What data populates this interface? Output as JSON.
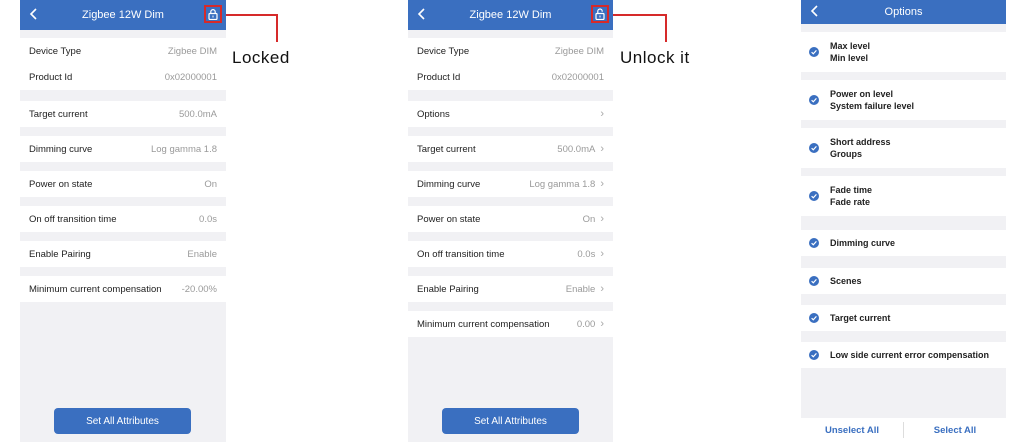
{
  "colors": {
    "primary": "#3a6fc0",
    "highlight": "#d62a2a",
    "background": "#f1f1f4"
  },
  "locked_screen": {
    "title": "Zigbee 12W Dim",
    "lock_icon": "lock-closed-icon",
    "rows": [
      {
        "label": "Device Type",
        "value": "Zigbee DIM"
      },
      {
        "label": "Product Id",
        "value": "0x02000001"
      },
      {
        "label": "Target current",
        "value": "500.0mA"
      },
      {
        "label": "Dimming curve",
        "value": "Log gamma 1.8"
      },
      {
        "label": "Power on state",
        "value": "On"
      },
      {
        "label": "On off transition time",
        "value": "0.0s"
      },
      {
        "label": "Enable Pairing",
        "value": "Enable"
      },
      {
        "label": "Minimum current compensation",
        "value": "-20.00%"
      }
    ],
    "button": "Set All Attributes"
  },
  "unlocked_screen": {
    "title": "Zigbee 12W Dim",
    "lock_icon": "lock-open-icon",
    "rows": [
      {
        "label": "Device Type",
        "value": "Zigbee DIM"
      },
      {
        "label": "Product Id",
        "value": "0x02000001"
      },
      {
        "label": "Options",
        "value": ""
      },
      {
        "label": "Target current",
        "value": "500.0mA"
      },
      {
        "label": "Dimming curve",
        "value": "Log gamma 1.8"
      },
      {
        "label": "Power on state",
        "value": "On"
      },
      {
        "label": "On off transition time",
        "value": "0.0s"
      },
      {
        "label": "Enable Pairing",
        "value": "Enable"
      },
      {
        "label": "Minimum current compensation",
        "value": "0.00"
      }
    ],
    "button": "Set All Attributes"
  },
  "options_screen": {
    "title": "Options",
    "items": [
      {
        "line1": "Max level",
        "line2": "Min level"
      },
      {
        "line1": "Power on level",
        "line2": "System failure level"
      },
      {
        "line1": "Short address",
        "line2": "Groups"
      },
      {
        "line1": "Fade time",
        "line2": "Fade rate"
      },
      {
        "line1": "Dimming curve",
        "line2": ""
      },
      {
        "line1": "Scenes",
        "line2": ""
      },
      {
        "line1": "Target current",
        "line2": ""
      },
      {
        "line1": "Low side current error compensation",
        "line2": ""
      }
    ],
    "unselect_all": "Unselect All",
    "select_all": "Select All"
  },
  "annotations": {
    "locked": "Locked",
    "unlock": "Unlock it"
  }
}
